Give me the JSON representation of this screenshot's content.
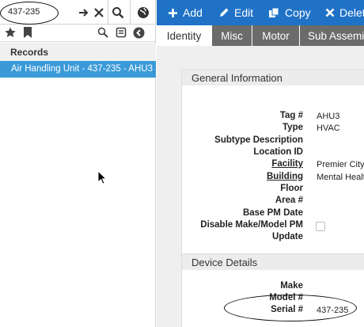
{
  "search": {
    "value": "437-235",
    "placeholder": ""
  },
  "sidebar": {
    "records_header": "Records",
    "records": [
      {
        "label": "Air Handling Unit - 437-235 - AHU3"
      }
    ]
  },
  "toolbar": {
    "add_label": "Add",
    "edit_label": "Edit",
    "copy_label": "Copy",
    "delete_label": "Delet"
  },
  "tabs": [
    {
      "label": "Identity",
      "active": true
    },
    {
      "label": "Misc"
    },
    {
      "label": "Motor"
    },
    {
      "label": "Sub Assemi"
    }
  ],
  "general": {
    "title": "General Information",
    "fields": [
      {
        "label": "Tag #",
        "value": "AHU3"
      },
      {
        "label": "Type",
        "value": "HVAC"
      },
      {
        "label": "Subtype Description",
        "value": ""
      },
      {
        "label": "Location ID",
        "value": ""
      },
      {
        "label": "Facility",
        "value": "Premier City",
        "link": true
      },
      {
        "label": "Building",
        "value": "Mental Healt",
        "link": true
      },
      {
        "label": "Floor",
        "value": ""
      },
      {
        "label": "Area #",
        "value": ""
      },
      {
        "label": "Base PM Date",
        "value": ""
      },
      {
        "label": "Disable Make/Model PM",
        "value": ""
      },
      {
        "label": "Update",
        "value": ""
      }
    ]
  },
  "device": {
    "title": "Device Details",
    "fields": [
      {
        "label": "Make",
        "value": ""
      },
      {
        "label": "Model #",
        "value": ""
      },
      {
        "label": "Serial #",
        "value": "437-235"
      }
    ]
  },
  "colors": {
    "toolbar": "#1f72c6",
    "selected_row": "#3a9ad9",
    "tab_inactive": "#6b6b6b"
  }
}
